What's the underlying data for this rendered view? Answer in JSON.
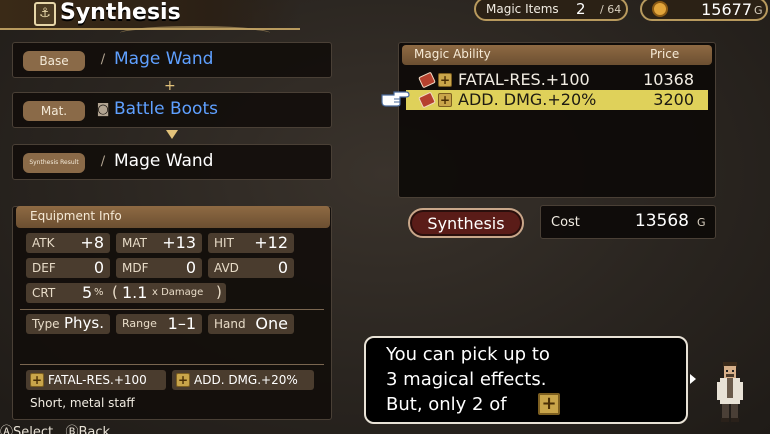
{
  "header": {
    "title": "Synthesis",
    "magic_items_label": "Magic Items",
    "magic_items_count": "2",
    "magic_items_max": "/ 64",
    "gold_amount": "15677",
    "gold_unit": "G"
  },
  "slots": {
    "base_tag": "Base",
    "base_item": "Mage Wand",
    "mat_tag": "Mat.",
    "mat_item": "Battle Boots",
    "result_tag": "Synthesis Result",
    "result_item": "Mage Wand"
  },
  "equipment_info": {
    "title": "Equipment Info",
    "stats": [
      {
        "label": "ATK",
        "value": "+8"
      },
      {
        "label": "MAT",
        "value": "+13"
      },
      {
        "label": "HIT",
        "value": "+12"
      },
      {
        "label": "DEF",
        "value": "0"
      },
      {
        "label": "MDF",
        "value": "0"
      },
      {
        "label": "AVD",
        "value": "0"
      }
    ],
    "crt_label": "CRT",
    "crt_value": "5",
    "crt_unit": "%",
    "crt_mult": "1.1",
    "crt_mult_suffix": "x Damage",
    "type_label": "Type",
    "type_value": "Phys.",
    "range_label": "Range",
    "range_value": "1–1",
    "hand_label": "Hand",
    "hand_value": "One",
    "effects": [
      "FATAL-RES.+100",
      "ADD. DMG.+20%"
    ],
    "description": "Short, metal staff"
  },
  "magic_ability": {
    "col_name": "Magic Ability",
    "col_price": "Price",
    "rows": [
      {
        "name": "FATAL-RES.+100",
        "price": "10368",
        "selected": false
      },
      {
        "name": "ADD. DMG.+20%",
        "price": "3200",
        "selected": true
      }
    ]
  },
  "actions": {
    "synthesis_label": "Synthesis",
    "cost_label": "Cost",
    "cost_value": "13568",
    "cost_unit": "G"
  },
  "dialog": {
    "line1": "You can pick up to",
    "line2": "3 magical effects.",
    "line3": "But, only 2 of"
  },
  "hints": {
    "text": "ⒶSelect   ⒷBack"
  },
  "colors": {
    "accent_gold": "#b89a5e",
    "selected_row": "#dfd15a",
    "item_name_blue": "#5fa0ff",
    "synthesis_button": "#5a1c18"
  },
  "icons": {
    "title": "synthesis-icon",
    "gold": "gold-coin-icon",
    "wand": "wand-icon",
    "boots": "boots-icon",
    "magic_book": "magic-book-icon",
    "plus": "plus-effect-icon",
    "pointer": "pointing-hand-icon"
  }
}
